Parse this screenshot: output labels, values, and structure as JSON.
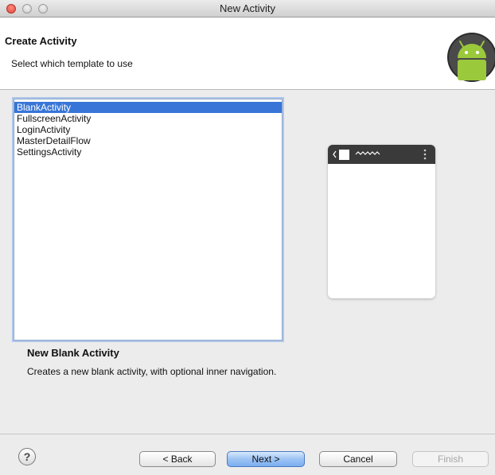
{
  "window": {
    "title": "New Activity"
  },
  "header": {
    "title": "Create Activity",
    "subtitle": "Select which template to use"
  },
  "templates": {
    "items": [
      "BlankActivity",
      "FullscreenActivity",
      "LoginActivity",
      "MasterDetailFlow",
      "SettingsActivity"
    ],
    "selected": "BlankActivity"
  },
  "description": {
    "title": "New Blank Activity",
    "text": "Creates a new blank activity, with optional inner navigation."
  },
  "footer": {
    "help_glyph": "?",
    "back_label": "< Back",
    "next_label": "Next >",
    "cancel_label": "Cancel",
    "finish_label": "Finish"
  },
  "colors": {
    "selection": "#3875d7",
    "android_green": "#9bc93c",
    "preview_bar": "#3a3a3a"
  }
}
